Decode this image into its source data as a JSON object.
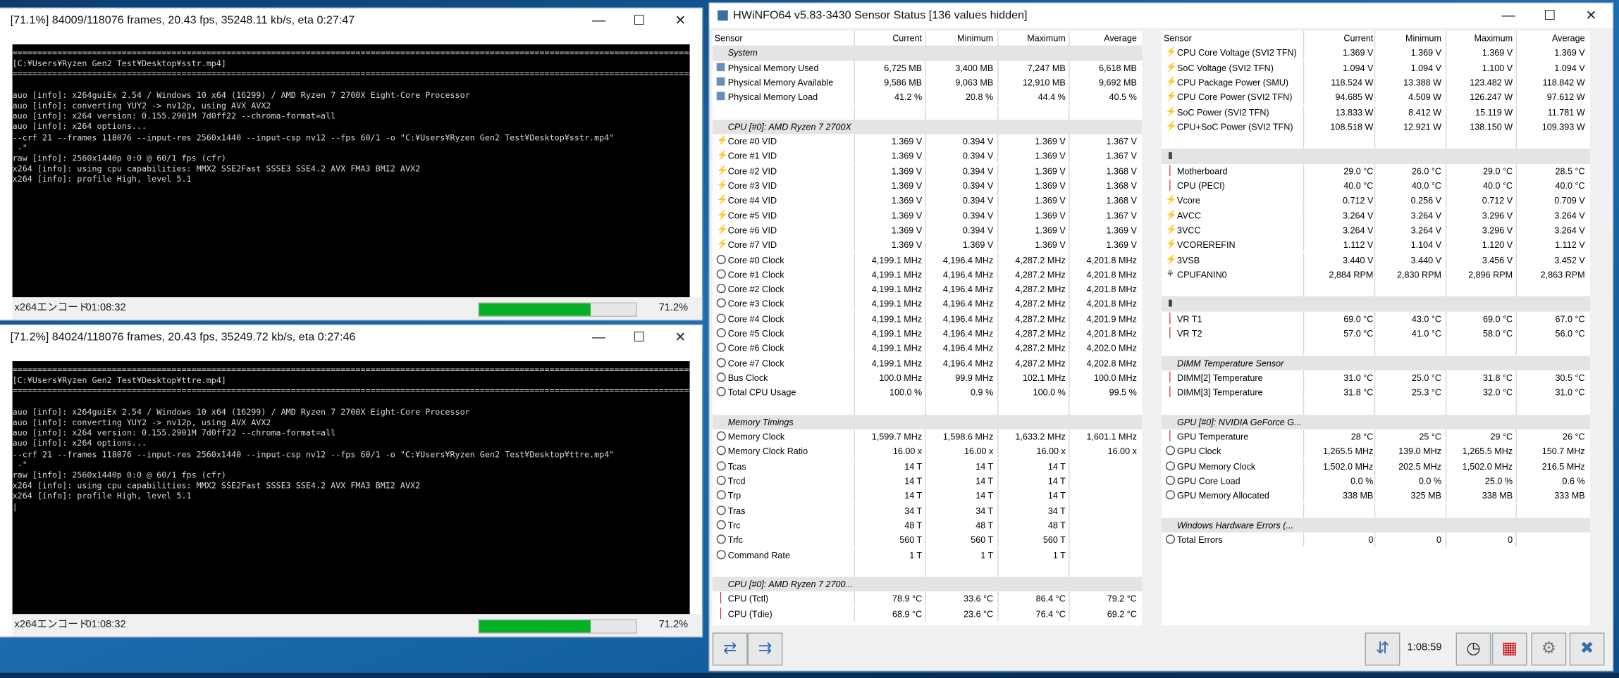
{
  "win1": {
    "title": "[71.1%] 84009/118076 frames, 20.43 fps, 35248.11 kb/s, eta 0:27:47",
    "console": [
      "[C:¥Users¥Ryzen Gen2 Test¥Desktop¥sstr.mp4]",
      "",
      "auo [info]: x264guiEx 2.54 / Windows 10 x64 (16299) / AMD Ryzen 7 2700X Eight-Core Processor",
      "auo [info]: converting YUY2 -> nv12p, using AVX AVX2",
      "auo [info]: x264 version: 0.155.2901M 7d0ff22 --chroma-format=all",
      "auo [info]: x264 options...",
      "--crf 21 --frames 118076 --input-res 2560x1440 --input-csp nv12 --fps 60/1 -o \"C:¥Users¥Ryzen Gen2 Test¥Desktop¥sstr.mp4\"",
      " -\"",
      "raw [info]: 2560x1440p 0:0 @ 60/1 fps (cfr)",
      "x264 [info]: using cpu capabilities: MMX2 SSE2Fast SSSE3 SSE4.2 AVX FMA3 BMI2 AVX2",
      "x264 [info]: profile High, level 5.1"
    ],
    "status_label": "x264エンコード",
    "time": "01:08:32",
    "progress": 0.712,
    "percent": "71.2%"
  },
  "win2": {
    "title": "[71.2%] 84024/118076 frames, 20.43 fps, 35249.72 kb/s, eta 0:27:46",
    "console": [
      "[C:¥Users¥Ryzen Gen2 Test¥Desktop¥ttre.mp4]",
      "",
      "auo [info]: x264guiEx 2.54 / Windows 10 x64 (16299) / AMD Ryzen 7 2700X Eight-Core Processor",
      "auo [info]: converting YUY2 -> nv12p, using AVX AVX2",
      "auo [info]: x264 version: 0.155.2901M 7d0ff22 --chroma-format=all",
      "auo [info]: x264 options...",
      "--crf 21 --frames 118076 --input-res 2560x1440 --input-csp nv12 --fps 60/1 -o \"C:¥Users¥Ryzen Gen2 Test¥Desktop¥ttre.mp4\"",
      " -\"",
      "raw [info]: 2560x1440p 0:0 @ 60/1 fps (cfr)",
      "x264 [info]: using cpu capabilities: MMX2 SSE2Fast SSSE3 SSE4.2 AVX FMA3 BMI2 AVX2",
      "x264 [info]: profile High, level 5.1",
      "|"
    ],
    "status_label": "x264エンコード",
    "time": "01:08:32",
    "progress": 0.712,
    "percent": "71.2%"
  },
  "hwinfo": {
    "title": "HWiNFO64 v5.83-3430 Sensor Status [136 values hidden]",
    "headers": [
      "Sensor",
      "Current",
      "Minimum",
      "Maximum",
      "Average"
    ],
    "left": [
      [
        "g",
        "System",
        "",
        "",
        "",
        ""
      ],
      [
        "s",
        "Physical Memory Used",
        "6,725 MB",
        "3,400 MB",
        "7,247 MB",
        "6,618 MB"
      ],
      [
        "s",
        "Physical Memory Available",
        "9,586 MB",
        "9,063 MB",
        "12,910 MB",
        "9,692 MB"
      ],
      [
        "s",
        "Physical Memory Load",
        "41.2 %",
        "20.8 %",
        "44.4 %",
        "40.5 %"
      ],
      [
        "b",
        "",
        "",
        "",
        "",
        ""
      ],
      [
        "g",
        "CPU [#0]: AMD Ryzen 7 2700X",
        "",
        "",
        "",
        ""
      ],
      [
        "v",
        "Core #0 VID",
        "1.369 V",
        "0.394 V",
        "1.369 V",
        "1.367 V"
      ],
      [
        "v",
        "Core #1 VID",
        "1.369 V",
        "0.394 V",
        "1.369 V",
        "1.367 V"
      ],
      [
        "v",
        "Core #2 VID",
        "1.369 V",
        "0.394 V",
        "1.369 V",
        "1.368 V"
      ],
      [
        "v",
        "Core #3 VID",
        "1.369 V",
        "0.394 V",
        "1.369 V",
        "1.368 V"
      ],
      [
        "v",
        "Core #4 VID",
        "1.369 V",
        "0.394 V",
        "1.369 V",
        "1.368 V"
      ],
      [
        "v",
        "Core #5 VID",
        "1.369 V",
        "0.394 V",
        "1.369 V",
        "1.367 V"
      ],
      [
        "v",
        "Core #6 VID",
        "1.369 V",
        "0.394 V",
        "1.369 V",
        "1.369 V"
      ],
      [
        "v",
        "Core #7 VID",
        "1.369 V",
        "1.369 V",
        "1.369 V",
        "1.369 V"
      ],
      [
        "c",
        "Core #0 Clock",
        "4,199.1 MHz",
        "4,196.4 MHz",
        "4,287.2 MHz",
        "4,201.8 MHz"
      ],
      [
        "c",
        "Core #1 Clock",
        "4,199.1 MHz",
        "4,196.4 MHz",
        "4,287.2 MHz",
        "4,201.8 MHz"
      ],
      [
        "c",
        "Core #2 Clock",
        "4,199.1 MHz",
        "4,196.4 MHz",
        "4,287.2 MHz",
        "4,201.8 MHz"
      ],
      [
        "c",
        "Core #3 Clock",
        "4,199.1 MHz",
        "4,196.4 MHz",
        "4,287.2 MHz",
        "4,201.8 MHz"
      ],
      [
        "c",
        "Core #4 Clock",
        "4,199.1 MHz",
        "4,196.4 MHz",
        "4,287.2 MHz",
        "4,201.9 MHz"
      ],
      [
        "c",
        "Core #5 Clock",
        "4,199.1 MHz",
        "4,196.4 MHz",
        "4,287.2 MHz",
        "4,201.8 MHz"
      ],
      [
        "c",
        "Core #6 Clock",
        "4,199.1 MHz",
        "4,196.4 MHz",
        "4,287.2 MHz",
        "4,202.0 MHz"
      ],
      [
        "c",
        "Core #7 Clock",
        "4,199.1 MHz",
        "4,196.4 MHz",
        "4,287.2 MHz",
        "4,202.8 MHz"
      ],
      [
        "c",
        "Bus Clock",
        "100.0 MHz",
        "99.9 MHz",
        "102.1 MHz",
        "100.0 MHz"
      ],
      [
        "c",
        "Total CPU Usage",
        "100.0 %",
        "0.9 %",
        "100.0 %",
        "99.5 %"
      ],
      [
        "b",
        "",
        "",
        "",
        "",
        ""
      ],
      [
        "g",
        "Memory Timings",
        "",
        "",
        "",
        ""
      ],
      [
        "c",
        "Memory Clock",
        "1,599.7 MHz",
        "1,598.6 MHz",
        "1,633.2 MHz",
        "1,601.1 MHz"
      ],
      [
        "c",
        "Memory Clock Ratio",
        "16.00 x",
        "16.00 x",
        "16.00 x",
        "16.00 x"
      ],
      [
        "c",
        "Tcas",
        "14 T",
        "14 T",
        "14 T",
        ""
      ],
      [
        "c",
        "Trcd",
        "14 T",
        "14 T",
        "14 T",
        ""
      ],
      [
        "c",
        "Trp",
        "14 T",
        "14 T",
        "14 T",
        ""
      ],
      [
        "c",
        "Tras",
        "34 T",
        "34 T",
        "34 T",
        ""
      ],
      [
        "c",
        "Trc",
        "48 T",
        "48 T",
        "48 T",
        ""
      ],
      [
        "c",
        "Trfc",
        "560 T",
        "560 T",
        "560 T",
        ""
      ],
      [
        "c",
        "Command Rate",
        "1 T",
        "1 T",
        "1 T",
        ""
      ],
      [
        "b",
        "",
        "",
        "",
        "",
        ""
      ],
      [
        "g",
        "CPU [#0]: AMD Ryzen 7 2700...",
        "",
        "",
        "",
        ""
      ],
      [
        "t",
        "CPU (Tctl)",
        "78.9 °C",
        "33.6 °C",
        "86.4 °C",
        "79.2 °C"
      ],
      [
        "t",
        "CPU (Tdie)",
        "68.9 °C",
        "23.6 °C",
        "76.4 °C",
        "69.2 °C"
      ]
    ],
    "right": [
      [
        "v",
        "CPU Core Voltage (SVI2 TFN)",
        "1.369 V",
        "1.369 V",
        "1.369 V",
        "1.369 V"
      ],
      [
        "v",
        "SoC Voltage (SVI2 TFN)",
        "1.094 V",
        "1.094 V",
        "1.100 V",
        "1.094 V"
      ],
      [
        "v",
        "CPU Package Power (SMU)",
        "118.524 W",
        "13.388 W",
        "123.482 W",
        "118.842 W"
      ],
      [
        "v",
        "CPU Core Power (SVI2 TFN)",
        "94.685 W",
        "4.509 W",
        "126.247 W",
        "97.612 W"
      ],
      [
        "v",
        "SoC Power (SVI2 TFN)",
        "13.833 W",
        "8.412 W",
        "15.119 W",
        "11.781 W"
      ],
      [
        "v",
        "CPU+SoC Power (SVI2 TFN)",
        "108.518 W",
        "12.921 W",
        "138.150 W",
        "109.393 W"
      ],
      [
        "b",
        "",
        "",
        "",
        "",
        ""
      ],
      [
        "x",
        "",
        "",
        "",
        "",
        ""
      ],
      [
        "t",
        "Motherboard",
        "29.0 °C",
        "26.0 °C",
        "29.0 °C",
        "28.5 °C"
      ],
      [
        "t",
        "CPU (PECI)",
        "40.0 °C",
        "40.0 °C",
        "40.0 °C",
        "40.0 °C"
      ],
      [
        "v",
        "Vcore",
        "0.712 V",
        "0.256 V",
        "0.712 V",
        "0.709 V"
      ],
      [
        "v",
        "AVCC",
        "3.264 V",
        "3.264 V",
        "3.296 V",
        "3.264 V"
      ],
      [
        "v",
        "3VCC",
        "3.264 V",
        "3.264 V",
        "3.296 V",
        "3.264 V"
      ],
      [
        "v",
        "VCOREREFIN",
        "1.112 V",
        "1.104 V",
        "1.120 V",
        "1.112 V"
      ],
      [
        "v",
        "3VSB",
        "3.440 V",
        "3.440 V",
        "3.456 V",
        "3.452 V"
      ],
      [
        "f",
        "CPUFANIN0",
        "2,884 RPM",
        "2,830 RPM",
        "2,896 RPM",
        "2,863 RPM"
      ],
      [
        "b",
        "",
        "",
        "",
        "",
        ""
      ],
      [
        "x",
        "",
        "",
        "",
        "",
        ""
      ],
      [
        "t",
        "VR T1",
        "69.0 °C",
        "43.0 °C",
        "69.0 °C",
        "67.0 °C"
      ],
      [
        "t",
        "VR T2",
        "57.0 °C",
        "41.0 °C",
        "58.0 °C",
        "56.0 °C"
      ],
      [
        "b",
        "",
        "",
        "",
        "",
        ""
      ],
      [
        "g",
        "DIMM Temperature Sensor",
        "",
        "",
        "",
        ""
      ],
      [
        "t",
        "DIMM[2] Temperature",
        "31.0 °C",
        "25.0 °C",
        "31.8 °C",
        "30.5 °C"
      ],
      [
        "t",
        "DIMM[3] Temperature",
        "31.8 °C",
        "25.3 °C",
        "32.0 °C",
        "31.0 °C"
      ],
      [
        "b",
        "",
        "",
        "",
        "",
        ""
      ],
      [
        "g",
        "GPU [#0]: NVIDIA GeForce G...",
        "",
        "",
        "",
        ""
      ],
      [
        "t",
        "GPU Temperature",
        "28 °C",
        "25 °C",
        "29 °C",
        "26 °C"
      ],
      [
        "c",
        "GPU Clock",
        "1,265.5 MHz",
        "139.0 MHz",
        "1,265.5 MHz",
        "150.7 MHz"
      ],
      [
        "c",
        "GPU Memory Clock",
        "1,502.0 MHz",
        "202.5 MHz",
        "1,502.0 MHz",
        "216.5 MHz"
      ],
      [
        "c",
        "GPU Core Load",
        "0.0 %",
        "0.0 %",
        "25.0 %",
        "0.6 %"
      ],
      [
        "c",
        "GPU Memory Allocated",
        "338 MB",
        "325 MB",
        "338 MB",
        "333 MB"
      ],
      [
        "b",
        "",
        "",
        "",
        "",
        ""
      ],
      [
        "g",
        "Windows Hardware Errors (...",
        "",
        "",
        "",
        ""
      ],
      [
        "e",
        "Total Errors",
        "0",
        "0",
        "0",
        ""
      ]
    ],
    "elapsed": "1:08:59"
  }
}
